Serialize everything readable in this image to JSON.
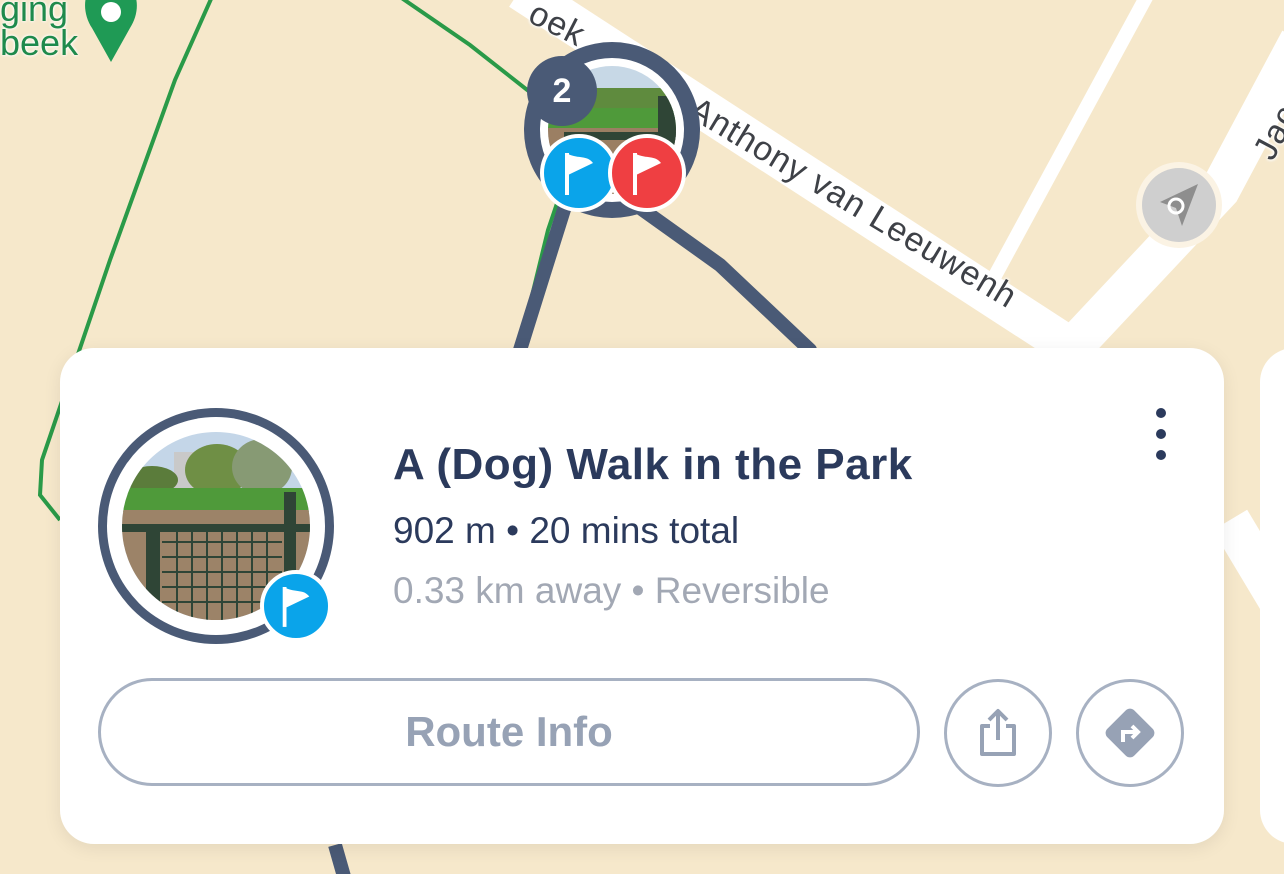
{
  "map": {
    "street_name": "Anthony van Leeuwenh",
    "street_fragment_top": "oek",
    "street_fragment_right": "Jaco",
    "poi_label_line1": "ging",
    "poi_label_line2": "beek",
    "cluster_count": "2",
    "colors": {
      "background": "#f6e8cb",
      "route_line": "#4a5a76",
      "trail_line": "#2a9a48",
      "poi": "#1f8a4c"
    }
  },
  "card": {
    "title": "A (Dog) Walk in the Park",
    "distance_duration": "902 m • 20 mins total",
    "away_reversible": "0.33 km away • Reversible",
    "route_info_label": "Route Info",
    "icons": {
      "more": "more-vertical-icon",
      "share": "share-icon",
      "directions": "directions-icon",
      "start": "start-flag-icon",
      "finish": "finish-flag-icon"
    },
    "colors": {
      "title": "#2b3a5c",
      "secondary": "#a2a8b4",
      "button_border": "#a7b1c2",
      "start_flag": "#0aa4ea",
      "finish_flag": "#ef3f42"
    }
  }
}
